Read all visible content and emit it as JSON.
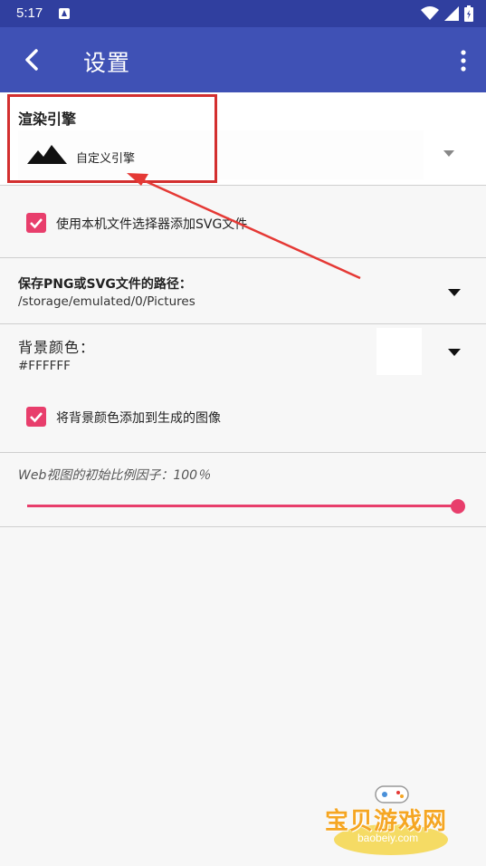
{
  "status_bar": {
    "time": "5:17",
    "app_icon": "a-notification-icon",
    "icons": [
      "wifi-icon",
      "signal-icon",
      "battery-icon"
    ]
  },
  "toolbar": {
    "title": "设置",
    "back_icon": "back-icon",
    "menu_icon": "overflow-menu-icon"
  },
  "renderer": {
    "title": "渲染引擎",
    "selected": "自定义引擎",
    "icon": "mountain-icon"
  },
  "file_picker": {
    "label": "使用本机文件选择器添加SVG文件",
    "checked": true
  },
  "save_path": {
    "title": "保存PNG或SVG文件的路径：",
    "value": "/storage/emulated/0/Pictures"
  },
  "background": {
    "title": "背景颜色：",
    "value": "#FFFFFF",
    "swatch_color": "#ffffff"
  },
  "add_bg": {
    "label": "将背景颜色添加到生成的图像",
    "checked": true
  },
  "web_scale": {
    "label": "Web视图的初始比例因子：100％",
    "percent": 100
  },
  "watermark": {
    "name": "宝贝游戏网",
    "url": "baobeiy.com"
  },
  "colors": {
    "primary": "#3f51b5",
    "primary_dark": "#303f9f",
    "accent": "#e83e6c",
    "annotation": "#d32f2f"
  }
}
